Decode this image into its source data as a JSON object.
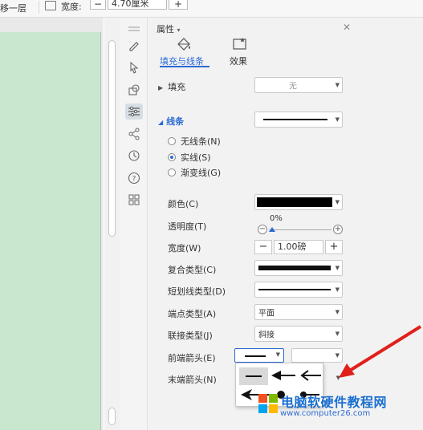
{
  "toolbar": {
    "layer_label": "移一层",
    "width_label": "宽度:",
    "width_value": "4.70厘米",
    "minus": "−",
    "plus": "+"
  },
  "panel": {
    "title": "属性",
    "title_caret": "▾",
    "close": "✕",
    "tabs": [
      {
        "label": "填充与线条",
        "active": true,
        "icon": "fill-bucket-icon"
      },
      {
        "label": "效果",
        "active": false,
        "icon": "effect-icon"
      }
    ],
    "fill_section": {
      "label": "填充",
      "value": "无"
    },
    "line_section": {
      "label": "线条",
      "options": [
        {
          "label": "无线条(N)",
          "checked": false
        },
        {
          "label": "实线(S)",
          "checked": true
        },
        {
          "label": "渐变线(G)",
          "checked": false
        }
      ]
    },
    "props": {
      "color_label": "颜色(C)",
      "color_value": "#000000",
      "transparency_label": "透明度(T)",
      "transparency_value": "0%",
      "width_label": "宽度(W)",
      "width_value": "1.00磅",
      "width_minus": "−",
      "width_plus": "+",
      "compound_label": "复合类型(C)",
      "dash_label": "短划线类型(D)",
      "cap_label": "端点类型(A)",
      "cap_value": "平面",
      "join_label": "联接类型(J)",
      "join_value": "斜接",
      "begin_arrow_label": "前端箭头(E)",
      "end_arrow_label": "末端箭头(N)",
      "end_arrow_partial": "头"
    }
  },
  "watermark": {
    "title": "电脑软硬件教程网",
    "url": "www.computer26.com"
  },
  "colors": {
    "accent": "#2b6ad3",
    "page_bg": "#c9e6cf",
    "annotation_arrow": "#e0201b"
  }
}
